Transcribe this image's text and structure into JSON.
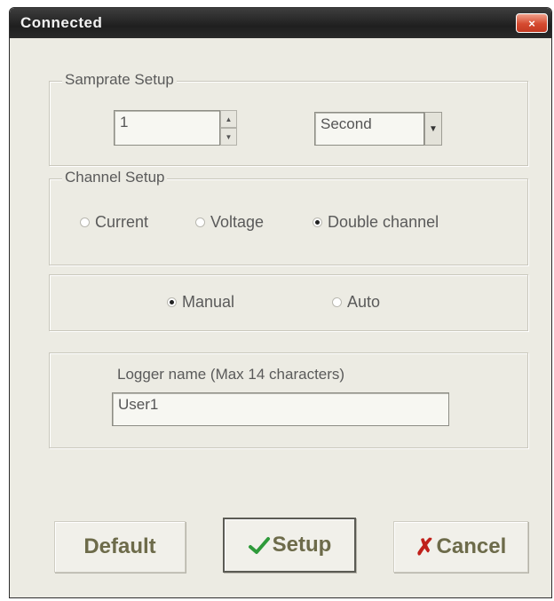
{
  "window": {
    "title": "Connected",
    "close_glyph": "×"
  },
  "samprate": {
    "legend": "Samprate Setup",
    "value": "1",
    "unit": "Second",
    "up_glyph": "▲",
    "down_glyph": "▼",
    "dropdown_glyph": "▼"
  },
  "channel": {
    "legend": "Channel Setup",
    "options": [
      "Current",
      "Voltage",
      "Double channel"
    ],
    "selected": "Double channel"
  },
  "mode": {
    "options": [
      "Manual",
      "Auto"
    ],
    "selected": "Manual"
  },
  "logger": {
    "legend": "Logger name (Max 14 characters)",
    "value": "User1"
  },
  "buttons": {
    "default_label": "Default",
    "setup_label": "Setup",
    "cancel_label": "Cancel",
    "cancel_glyph": "✗"
  },
  "icons": [
    "close-icon",
    "spin-up-icon",
    "spin-down-icon",
    "chevron-down-icon",
    "check-icon",
    "x-icon"
  ]
}
